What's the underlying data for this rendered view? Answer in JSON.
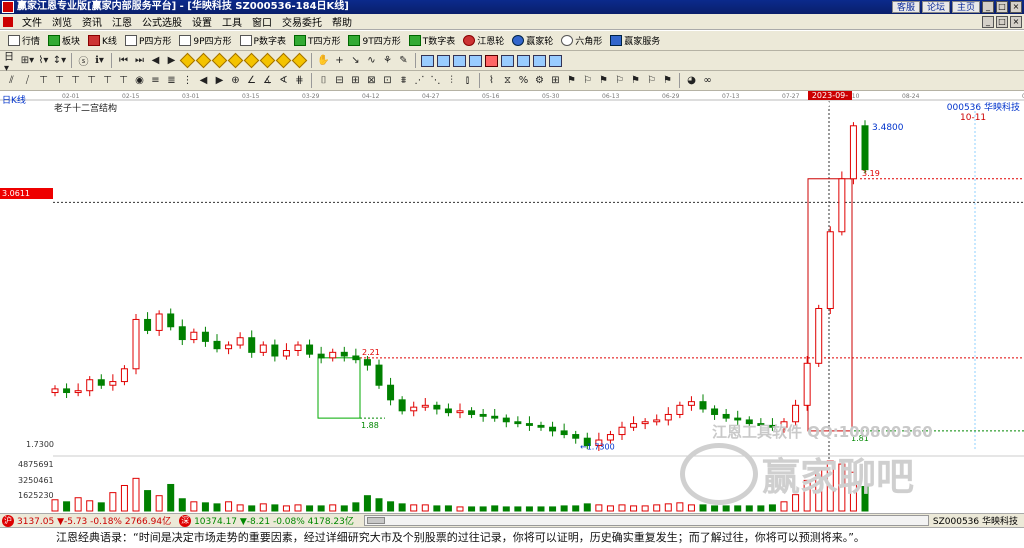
{
  "window": {
    "title": "赢家江恩专业版[赢家内部服务平台] - [华映科技  SZ000536-184日K线]",
    "links": [
      "客服",
      "论坛",
      "主页"
    ]
  },
  "menu": {
    "items": [
      "文件",
      "浏览",
      "资讯",
      "江恩",
      "公式选股",
      "设置",
      "工具",
      "窗口",
      "交易委托",
      "帮助"
    ]
  },
  "toolbar": {
    "items": [
      {
        "label": "行情",
        "icon": "grid-icon"
      },
      {
        "label": "板块",
        "icon": "blocks-icon"
      },
      {
        "label": "K线",
        "icon": "kline-icon"
      },
      {
        "label": "P四方形",
        "icon": "p-square-icon"
      },
      {
        "label": "9P四方形",
        "icon": "9p-square-icon"
      },
      {
        "label": "P数字表",
        "icon": "p-table-icon"
      },
      {
        "label": "T四方形",
        "icon": "t-square-icon"
      },
      {
        "label": "9T四方形",
        "icon": "9t-square-icon"
      },
      {
        "label": "T数字表",
        "icon": "t-table-icon"
      },
      {
        "label": "江恩轮",
        "icon": "gann-wheel-icon"
      },
      {
        "label": "赢家轮",
        "icon": "winner-wheel-icon"
      },
      {
        "label": "六角形",
        "icon": "hexagon-icon"
      },
      {
        "label": "赢家服务",
        "icon": "service-icon"
      }
    ]
  },
  "chart": {
    "period_label": "日K线",
    "indicator_label": "老子十二宫结构",
    "stock_code": "000536 华映科技",
    "marker_date": "10-11",
    "highlight_date": "2023-09-04",
    "current_price_box": "3.0611",
    "low_axis_label": "1.7300",
    "volume_ticks": [
      "4875691",
      "3250461",
      "1625230"
    ],
    "labels": {
      "peak": "3.4800",
      "level_319": "3.19",
      "level_221": "2.21",
      "level_188": "1.88",
      "level_181": "1.81",
      "low": "1.7300"
    },
    "watermark_text": "江恩工具软件  QQ:100800360",
    "watermark_brand": "赢家聊吧",
    "colors": {
      "up": "#e00000",
      "down": "#008000",
      "level": "#e00000"
    }
  },
  "chart_data": {
    "type": "candlestick",
    "x_ticks": [
      "02-01",
      "02-15",
      "03-01",
      "03-15",
      "03-29",
      "04-12",
      "04-27",
      "05-16",
      "05-30",
      "06-13",
      "06-29",
      "07-13",
      "07-27",
      "08-10",
      "08-24",
      "2023-09-04",
      "09-21",
      "10-08",
      "10-19"
    ],
    "close": [
      2.04,
      2.02,
      2.03,
      2.09,
      2.06,
      2.08,
      2.15,
      2.42,
      2.36,
      2.45,
      2.38,
      2.31,
      2.35,
      2.3,
      2.26,
      2.28,
      2.32,
      2.24,
      2.28,
      2.22,
      2.25,
      2.28,
      2.23,
      2.21,
      2.24,
      2.22,
      2.2,
      2.17,
      2.06,
      1.98,
      1.92,
      1.94,
      1.95,
      1.93,
      1.91,
      1.92,
      1.9,
      1.89,
      1.88,
      1.86,
      1.85,
      1.84,
      1.83,
      1.81,
      1.79,
      1.77,
      1.73,
      1.76,
      1.79,
      1.83,
      1.85,
      1.86,
      1.87,
      1.9,
      1.95,
      1.97,
      1.93,
      1.9,
      1.88,
      1.87,
      1.85,
      1.84,
      1.83,
      1.86,
      1.95,
      2.18,
      2.48,
      2.9,
      3.19,
      3.48,
      3.24
    ],
    "price_levels": [
      3.48,
      3.19,
      2.21,
      1.88,
      1.81,
      1.73
    ],
    "volume": [
      1.1,
      0.9,
      1.3,
      1.0,
      0.8,
      1.8,
      2.5,
      3.2,
      2.0,
      1.5,
      2.6,
      1.2,
      0.9,
      0.8,
      0.7,
      0.9,
      0.6,
      0.5,
      0.7,
      0.6,
      0.5,
      0.6,
      0.5,
      0.5,
      0.6,
      0.5,
      0.8,
      1.5,
      1.2,
      0.9,
      0.7,
      0.6,
      0.6,
      0.5,
      0.5,
      0.4,
      0.4,
      0.4,
      0.5,
      0.4,
      0.4,
      0.4,
      0.4,
      0.4,
      0.5,
      0.5,
      0.7,
      0.6,
      0.5,
      0.6,
      0.5,
      0.5,
      0.6,
      0.7,
      0.8,
      0.6,
      0.6,
      0.5,
      0.5,
      0.5,
      0.5,
      0.5,
      0.6,
      0.9,
      1.6,
      3.0,
      4.2,
      4.9,
      4.6,
      3.8,
      2.4
    ],
    "volume_unit_max": 4875691
  },
  "statusbar": {
    "sh_index": "3137.05 ▼-5.73 -0.18% 2766.94亿",
    "sz_index": "10374.17 ▼-8.21 -0.08% 4178.23亿",
    "right_code": "SZ000536 华映科技"
  },
  "quote": "江恩经典语录：“时间是决定市场走势的重要因素，经过详细研究大市及个别股票的过往记录，你将可以证明，历史确实重复发生；而了解过往，你将可以预测将来。”。"
}
